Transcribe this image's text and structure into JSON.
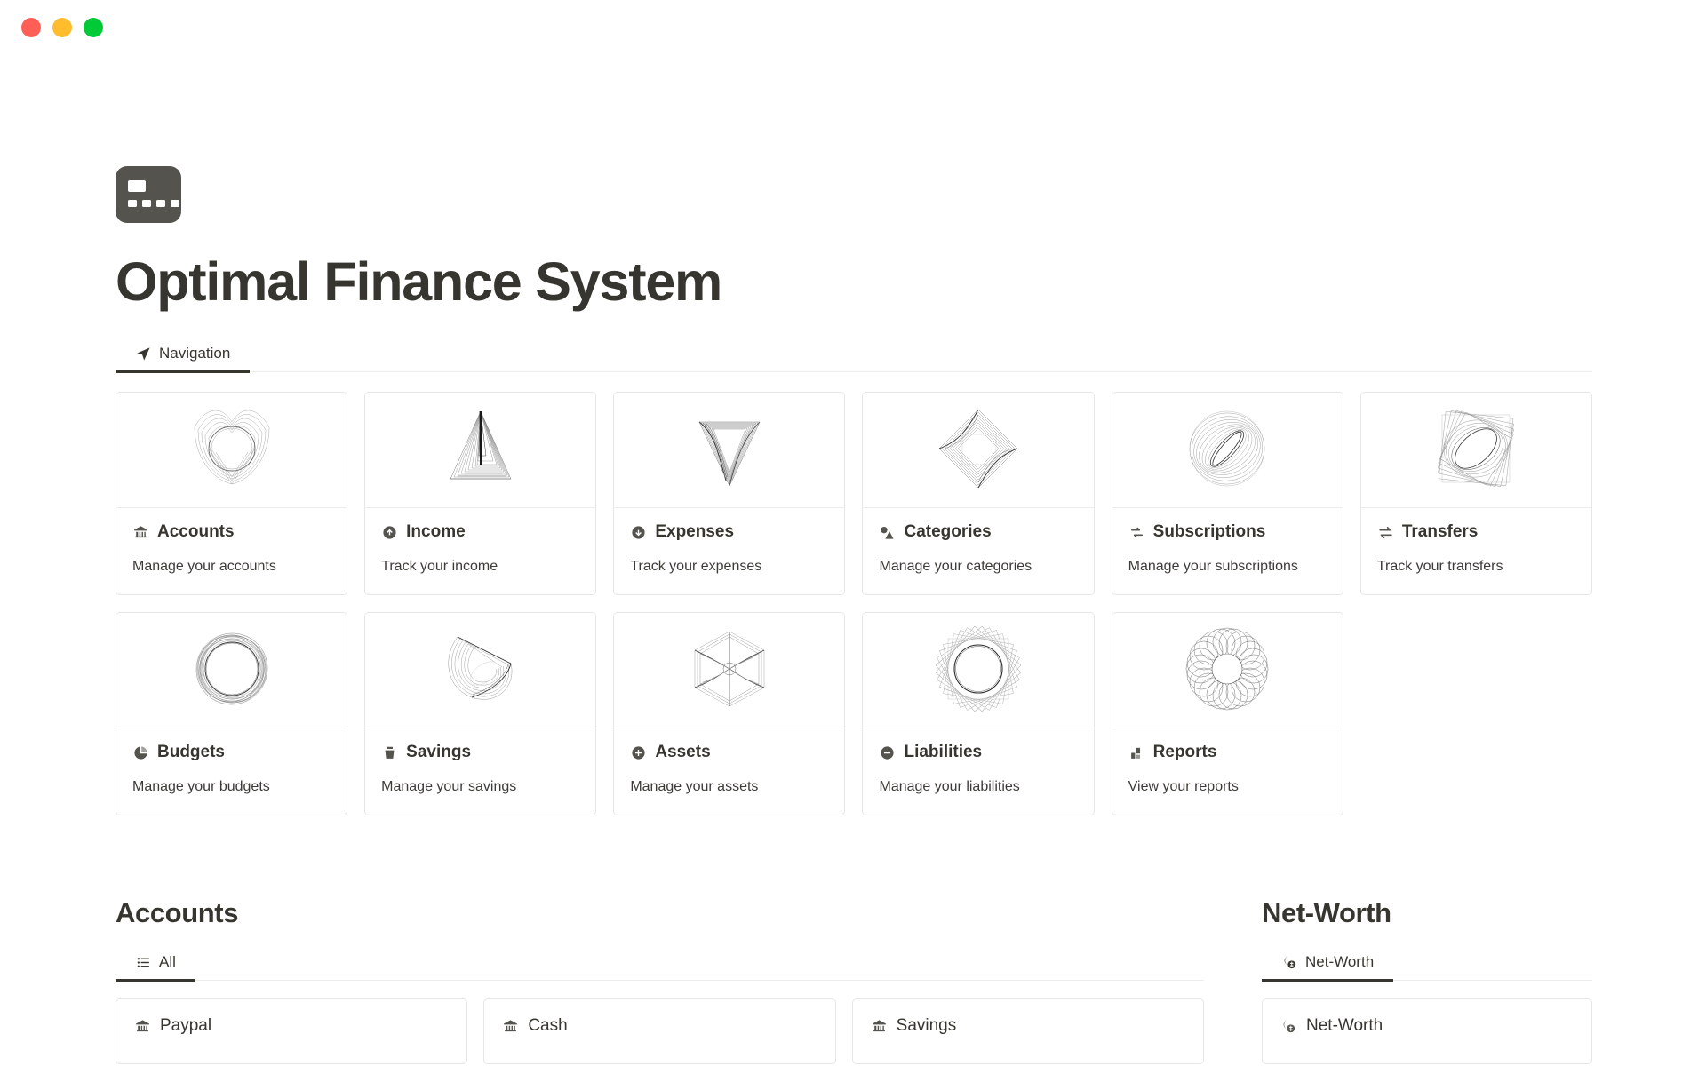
{
  "window": {
    "controls": [
      {
        "name": "close",
        "color": "#ff5f57"
      },
      {
        "name": "minimize",
        "color": "#ffbd2e"
      },
      {
        "name": "maximize",
        "color": "#00ca35"
      }
    ]
  },
  "header": {
    "icon": "credit-card-icon",
    "title": "Optimal Finance System"
  },
  "nav_tabs": [
    {
      "label": "Navigation",
      "icon": "send-icon",
      "active": true
    }
  ],
  "nav_cards": [
    {
      "title": "Accounts",
      "desc": "Manage your accounts",
      "icon": "bank-icon",
      "art": "accounts-art"
    },
    {
      "title": "Income",
      "desc": "Track your income",
      "icon": "arrow-up-circle-icon",
      "art": "income-art"
    },
    {
      "title": "Expenses",
      "desc": "Track your expenses",
      "icon": "arrow-down-circle-icon",
      "art": "expenses-art"
    },
    {
      "title": "Categories",
      "desc": "Manage your categories",
      "icon": "shapes-icon",
      "art": "categories-art"
    },
    {
      "title": "Subscriptions",
      "desc": "Manage your subscriptions",
      "icon": "repeat-icon",
      "art": "subscriptions-art"
    },
    {
      "title": "Transfers",
      "desc": "Track your transfers",
      "icon": "arrows-exchange-icon",
      "art": "transfers-art"
    },
    {
      "title": "Budgets",
      "desc": "Manage your budgets",
      "icon": "pie-chart-icon",
      "art": "budgets-art"
    },
    {
      "title": "Savings",
      "desc": "Manage your savings",
      "icon": "piggy-bank-icon",
      "art": "savings-art"
    },
    {
      "title": "Assets",
      "desc": "Manage your assets",
      "icon": "plus-circle-icon",
      "art": "assets-art"
    },
    {
      "title": "Liabilities",
      "desc": "Manage your liabilities",
      "icon": "minus-circle-icon",
      "art": "liabilities-art"
    },
    {
      "title": "Reports",
      "desc": "View your reports",
      "icon": "bar-chart-icon",
      "art": "reports-art"
    }
  ],
  "accounts_section": {
    "title": "Accounts",
    "tabs": [
      {
        "label": "All",
        "icon": "list-icon",
        "active": true
      }
    ],
    "items": [
      {
        "label": "Paypal",
        "icon": "bank-icon"
      },
      {
        "label": "Cash",
        "icon": "bank-icon"
      },
      {
        "label": "Savings",
        "icon": "bank-icon"
      }
    ]
  },
  "networth_section": {
    "title": "Net-Worth",
    "tabs": [
      {
        "label": "Net-Worth",
        "icon": "coins-icon",
        "active": true
      }
    ],
    "items": [
      {
        "label": "Net-Worth",
        "icon": "coins-icon"
      }
    ]
  },
  "colors": {
    "text": "#37352f",
    "border": "#e6e6e4",
    "divider": "#ededeb",
    "accent": "#37352f",
    "icon_fill": "#55534e"
  }
}
